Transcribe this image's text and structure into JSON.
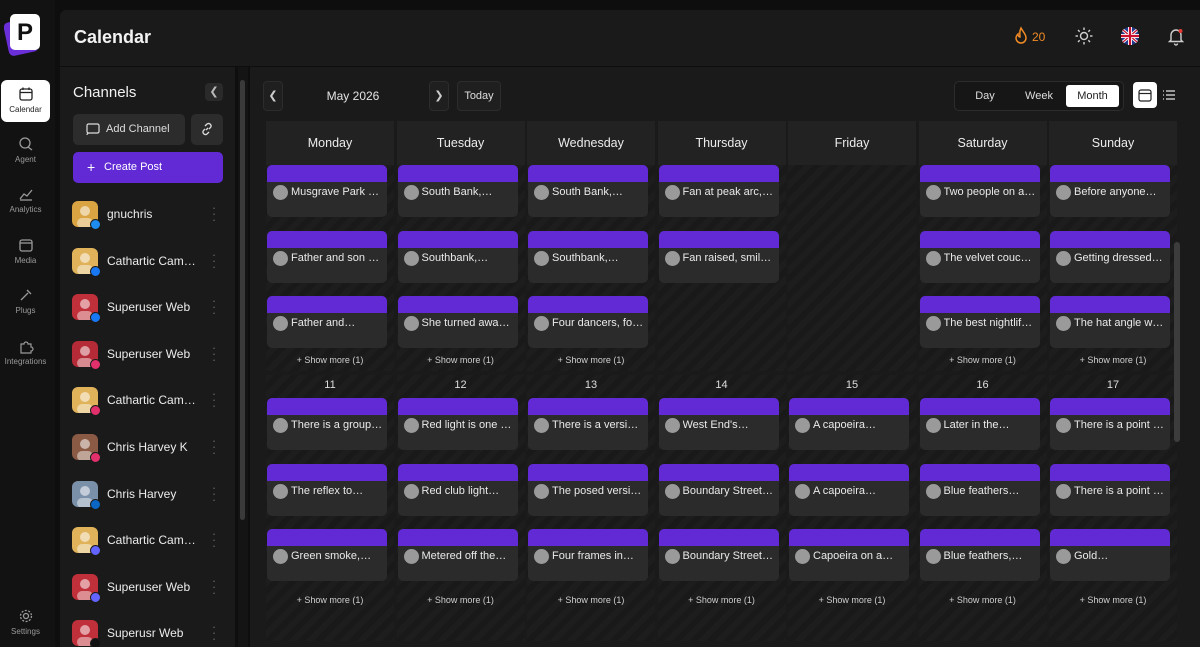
{
  "nav": {
    "items": [
      {
        "label": "Calendar",
        "icon": "calendar-icon",
        "active": true
      },
      {
        "label": "Agent",
        "icon": "chat-icon"
      },
      {
        "label": "Analytics",
        "icon": "analytics-icon"
      },
      {
        "label": "Media",
        "icon": "media-icon"
      },
      {
        "label": "Plugs",
        "icon": "plug-icon"
      },
      {
        "label": "Integrations",
        "icon": "puzzle-icon"
      },
      {
        "label": "Settings",
        "icon": "gear-icon"
      }
    ]
  },
  "header": {
    "title": "Calendar",
    "streak_count": "20"
  },
  "channels": {
    "title": "Channels",
    "add_label": "Add Channel",
    "create_label": "Create Post",
    "list": [
      {
        "name": "gnuchris",
        "network": "bluesky",
        "color": "#1d8bf0"
      },
      {
        "name": "Cathartic Camera",
        "network": "facebook",
        "color": "#1877f2"
      },
      {
        "name": "Superuser Web",
        "network": "facebook",
        "color": "#1877f2"
      },
      {
        "name": "Superuser Web",
        "network": "instagram",
        "color": "#e1306c"
      },
      {
        "name": "Cathartic Camera",
        "network": "instagram",
        "color": "#e1306c"
      },
      {
        "name": "Chris Harvey K",
        "network": "instagram",
        "color": "#e1306c"
      },
      {
        "name": "Chris Harvey",
        "network": "linkedin",
        "color": "#0a66c2"
      },
      {
        "name": "Cathartic Camera",
        "network": "mastodon",
        "color": "#6364ff"
      },
      {
        "name": "Superuser Web",
        "network": "mastodon",
        "color": "#6364ff"
      },
      {
        "name": "Superusr Web",
        "network": "x",
        "color": "#111111"
      }
    ]
  },
  "calendar": {
    "month_label": "May 2026",
    "today_label": "Today",
    "views": [
      "Day",
      "Week",
      "Month"
    ],
    "active_view": "Month",
    "days": [
      "Monday",
      "Tuesday",
      "Wednesday",
      "Thursday",
      "Friday",
      "Saturday",
      "Sunday"
    ],
    "show_more": "+ Show more (1)",
    "week1": {
      "cols": [
        [
          "Musgrave Park o…",
          "Father and son at…",
          "Father and…"
        ],
        [
          "South Bank,…",
          "Southbank,…",
          "She turned away…"
        ],
        [
          "South Bank,…",
          "Southbank,…",
          "Four dancers, fo…"
        ],
        [
          "Fan at peak arc,…",
          "Fan raised, smile…"
        ],
        [],
        [
          "Two people on a…",
          "The velvet couch…",
          "The best nightlife…"
        ],
        [
          "Before anyone…",
          "Getting dressed…",
          "The hat angle wa…"
        ]
      ],
      "show_more": [
        true,
        true,
        true,
        false,
        false,
        true,
        true
      ]
    },
    "week2": {
      "dates": [
        "11",
        "12",
        "13",
        "14",
        "15",
        "16",
        "17"
      ],
      "cols": [
        [
          "There is a group …",
          "The reflex to…",
          "Green smoke,…"
        ],
        [
          "Red light is one o…",
          "Red club light…",
          "Metered off the…"
        ],
        [
          "There is a version…",
          "The posed versio…",
          "Four frames in…"
        ],
        [
          "West End's…",
          "Boundary Street…",
          "Boundary Street…"
        ],
        [
          "A capoeira…",
          "A capoeira…",
          "Capoeira on a…"
        ],
        [
          "Later in the…",
          "Blue feathers…",
          "Blue feathers,…"
        ],
        [
          "There is a point i…",
          "There is a point i…",
          "Gold…"
        ]
      ]
    },
    "colors": {
      "accent": "#612ad5",
      "streak": "#f08a24"
    }
  }
}
